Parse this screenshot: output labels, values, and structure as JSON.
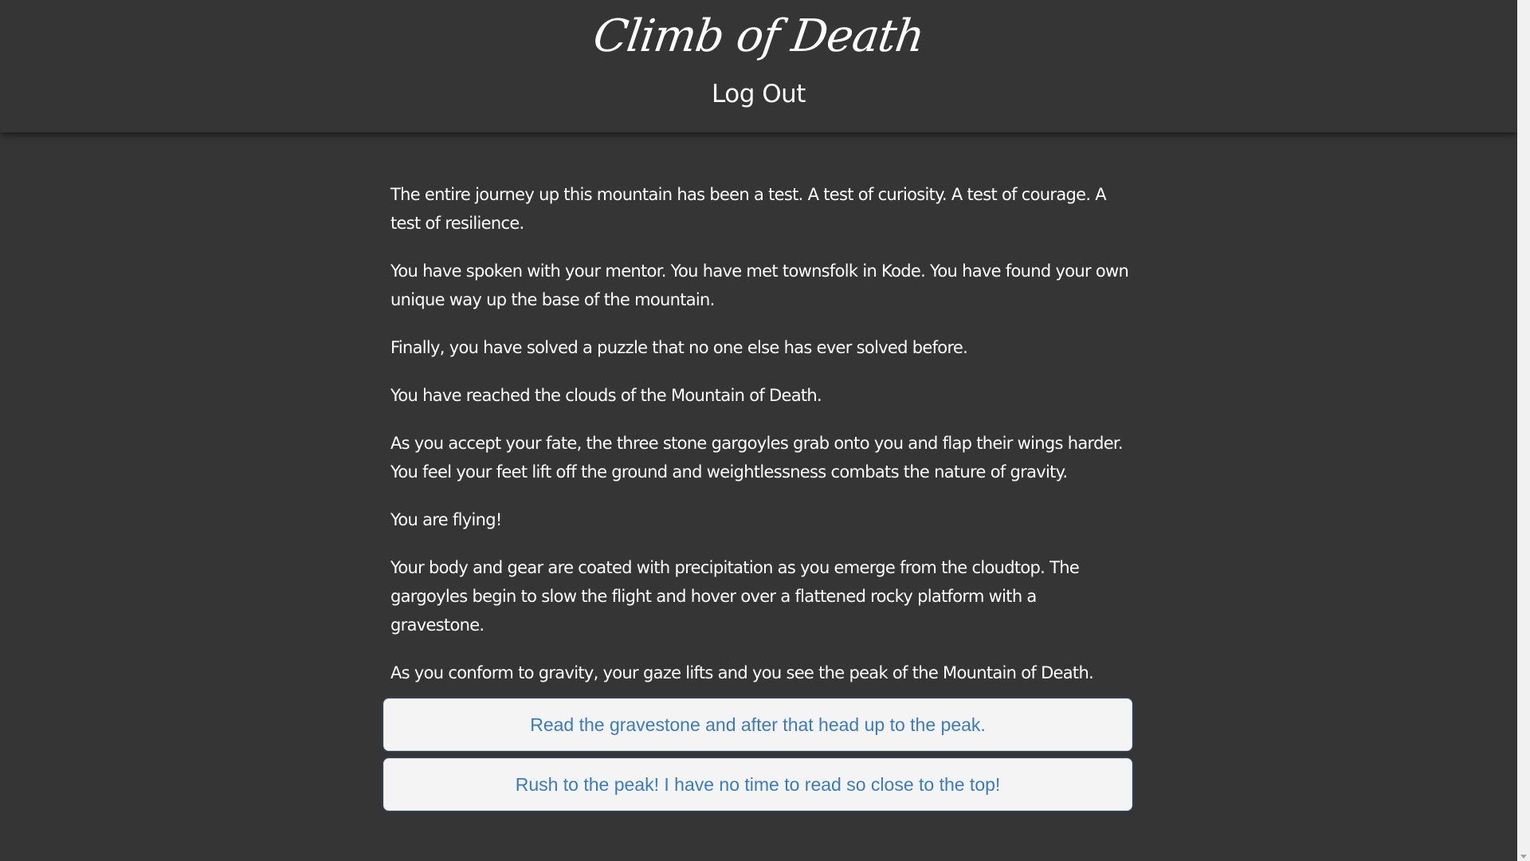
{
  "header": {
    "logo_text": "Climb of Death",
    "logout_label": "Log Out"
  },
  "story": {
    "paragraphs": [
      "The entire journey up this mountain has been a test. A test of curiosity. A test of courage. A test of resilience.",
      "You have spoken with your mentor. You have met townsfolk in Kode. You have found your own unique way up the base of the mountain.",
      "Finally, you have solved a puzzle that no one else has ever solved before.",
      "You have reached the clouds of the Mountain of Death.",
      "As you accept your fate, the three stone gargoyles grab onto you and flap their wings harder. You feel your feet lift off the ground and weightlessness combats the nature of gravity.",
      "You are flying!",
      "Your body and gear are coated with precipitation as you emerge from the cloudtop. The gargoyles begin to slow the flight and hover over a flattened rocky platform with a gravestone.",
      "As you conform to gravity, your gaze lifts and you see the peak of the Mountain of Death."
    ]
  },
  "choices": [
    {
      "label": "Read the gravestone and after that head up to the peak."
    },
    {
      "label": "Rush to the peak! I have no time to read so close to the top!"
    }
  ],
  "colors": {
    "background": "#353535",
    "choice_background": "#f4f4f5",
    "choice_text": "#3b7bbf"
  },
  "icons": {
    "scrollbar": "chevron-down-icon"
  }
}
